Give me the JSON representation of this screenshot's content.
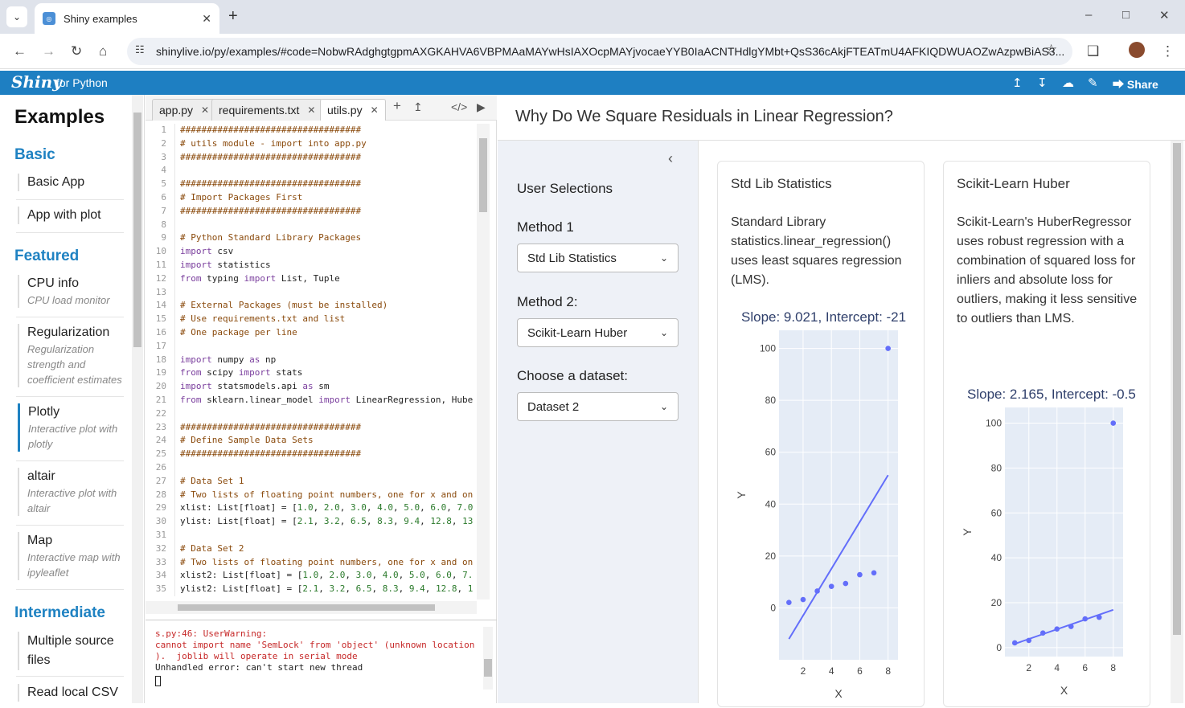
{
  "browser": {
    "tab_title": "Shiny examples",
    "url": "shinylive.io/py/examples/#code=NobwRAdghgtgpmAXGKAHVA6VBPMAaMAYwHsIAXOcpMAYjvocaeYYB0IaACNTHdlgYMbt+QsS36cAkjFTEATmU4AFKIQDWUAOZwAzpwBiAS3..."
  },
  "shiny": {
    "brand": "Shiny",
    "brand_sub": "for Python",
    "share": "Share"
  },
  "sidebar": {
    "title": "Examples",
    "categories": [
      "Basic",
      "Featured",
      "Intermediate"
    ],
    "items": [
      {
        "title": "Basic App",
        "desc": ""
      },
      {
        "title": "App with plot",
        "desc": ""
      },
      {
        "title": "CPU info",
        "desc": "CPU load monitor"
      },
      {
        "title": "Regularization",
        "desc": "Regularization strength and coefficient estimates"
      },
      {
        "title": "Plotly",
        "desc": "Interactive plot with plotly"
      },
      {
        "title": "altair",
        "desc": "Interactive plot with altair"
      },
      {
        "title": "Map",
        "desc": "Interactive map with ipyleaflet"
      },
      {
        "title": "Multiple source files",
        "desc": ""
      },
      {
        "title": "Read local CSV",
        "desc": ""
      }
    ]
  },
  "editor": {
    "tabs": [
      "app.py",
      "requirements.txt",
      "utils.py"
    ],
    "console": [
      "s.py:46: UserWarning:",
      "cannot import name 'SemLock' from 'object' (unknown location",
      ").  joblib will operate in serial mode",
      "Unhandled error: can't start new thread"
    ]
  },
  "app": {
    "title": "Why Do We Square Residuals in Linear Regression?",
    "sidebar_title": "User Selections",
    "method1_label": "Method 1",
    "method1_value": "Std Lib Statistics",
    "method2_label": "Method 2:",
    "method2_value": "Scikit-Learn Huber",
    "dataset_label": "Choose a dataset:",
    "dataset_value": "Dataset 2",
    "card1": {
      "title": "Std Lib Statistics",
      "desc": "Standard Library statistics.linear_regression() uses least squares regression (LMS).",
      "slope": "Slope: 9.021, Intercept: -21"
    },
    "card2": {
      "title": "Scikit-Learn Huber",
      "desc": "Scikit-Learn's HuberRegressor uses robust regression with a combination of squared loss for inliers and absolute loss for outliers, making it less sensitive to outliers than LMS.",
      "slope": "Slope: 2.165, Intercept: -0.5"
    }
  },
  "chart_data": [
    {
      "type": "scatter",
      "xlabel": "X",
      "ylabel": "Y",
      "xticks": [
        2,
        4,
        6,
        8
      ],
      "yticks": [
        0,
        20,
        40,
        60,
        80,
        100
      ],
      "xlim": [
        0.3,
        8.7
      ],
      "ylim": [
        -20,
        107
      ],
      "x": [
        1,
        2,
        3,
        4,
        5,
        6,
        7,
        8
      ],
      "y": [
        2.1,
        3.2,
        6.5,
        8.3,
        9.4,
        12.8,
        13.5,
        100
      ],
      "line": {
        "slope": 9.021,
        "intercept": -21
      },
      "color": "#636efa"
    },
    {
      "type": "scatter",
      "xlabel": "X",
      "ylabel": "Y",
      "xticks": [
        2,
        4,
        6,
        8
      ],
      "yticks": [
        0,
        20,
        40,
        60,
        80,
        100
      ],
      "xlim": [
        0.3,
        8.7
      ],
      "ylim": [
        -4,
        107
      ],
      "x": [
        1,
        2,
        3,
        4,
        5,
        6,
        7,
        8
      ],
      "y": [
        2.1,
        3.2,
        6.5,
        8.3,
        9.4,
        12.8,
        13.5,
        100
      ],
      "line": {
        "slope": 2.165,
        "intercept": -0.5
      },
      "color": "#636efa"
    }
  ]
}
